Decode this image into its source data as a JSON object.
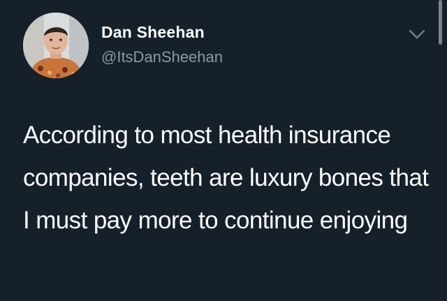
{
  "tweet": {
    "author_name": "Dan Sheehan",
    "author_handle": "@ItsDanSheehan",
    "text": "According to most health insurance companies, teeth are luxury bones that I must pay more to continue enjoying",
    "menu_icon": "chevron-down-icon"
  },
  "colors": {
    "background": "#15202b",
    "name": "#ffffff",
    "handle": "#8899a6",
    "text": "#ffffff"
  }
}
